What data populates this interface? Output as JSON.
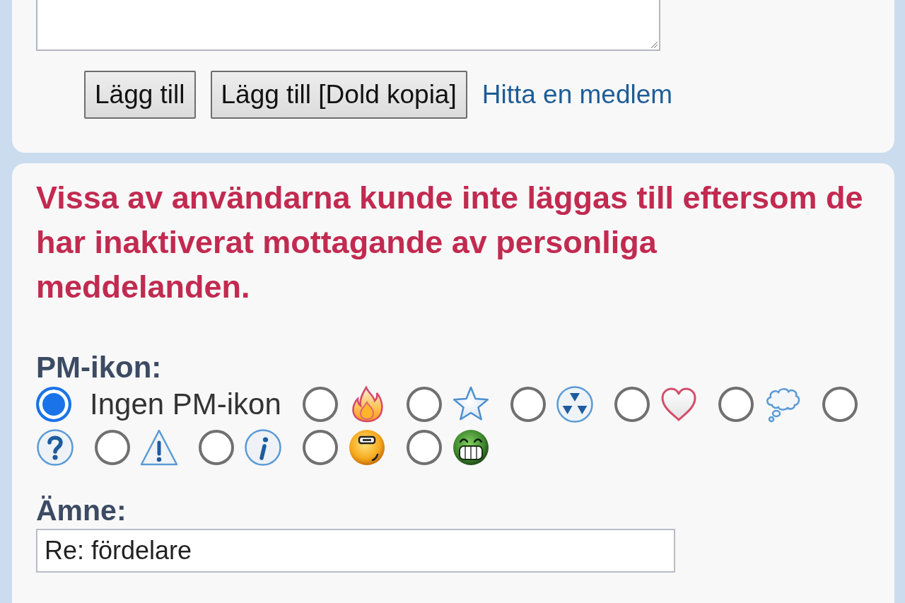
{
  "message_field": {
    "resizable": true
  },
  "buttons": [
    {
      "label": "Lägg till"
    },
    {
      "label": "Lägg till [Dold kopia]"
    }
  ],
  "find_member_link": "Hitta en medlem",
  "error_message": "Vissa av användarna kunde inte läggas till eftersom de har inaktiverat mottagande av personliga meddelanden.",
  "pm_icon": {
    "label": "PM-ikon:",
    "options": [
      {
        "kind": "none",
        "label": "Ingen PM-ikon",
        "selected": true
      },
      {
        "kind": "fire",
        "selected": false
      },
      {
        "kind": "star",
        "selected": false
      },
      {
        "kind": "radiation",
        "selected": false
      },
      {
        "kind": "heart",
        "selected": false
      },
      {
        "kind": "thought_bubble",
        "selected": false
      },
      {
        "kind": "question",
        "selected": false
      },
      {
        "kind": "warning",
        "selected": false
      },
      {
        "kind": "info",
        "selected": false
      },
      {
        "kind": "face",
        "selected": false
      },
      {
        "kind": "grin",
        "selected": false
      }
    ]
  },
  "subject": {
    "label": "Ämne:",
    "value": "Re: fördelare"
  }
}
